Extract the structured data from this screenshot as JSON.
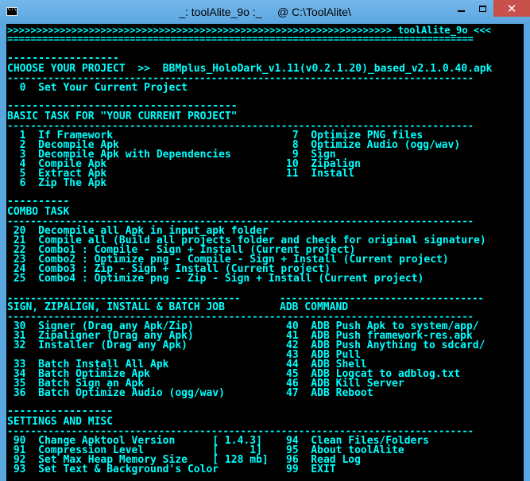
{
  "window": {
    "title": "_: toolAlite_9o :_     @ C:\\ToolAlite\\",
    "close_label": "✕"
  },
  "console": {
    "header_bar": ">>>>>>>>>>>>>>>>>>>>>>>>>>>>>>>>>>>>>>>>>>>>>>>>>>>>>>>>>>>>>>>>>> toolAlite_9o <<<",
    "rule": "================================================================================",
    "choose_rule": "------------------",
    "choose_label": "CHOOSE YOUR PROJECT  >>  BBMplus_HoloDark_v1.11(v0.2.1.20)_based_v2.1.0.40.apk",
    "dash_rule": "--------------------------------------------------------------------------------",
    "option_0": "  0  Set Your Current Project",
    "basic_rule": "-------------------------------------",
    "basic_title": "BASIC TASK FOR \"YOUR CURRENT PROJECT\"",
    "basic": [
      "  1  If Framework",
      "  2  Decompile Apk",
      "  3  Decompile Apk with Dependencies",
      "  4  Compile Apk",
      "  5  Extract Apk",
      "  6  Zip The Apk"
    ],
    "basic_right": [
      " 7  Optimize PNG files",
      " 8  Optimize Audio (ogg/wav)",
      " 9  Sign",
      "10  Zipalign",
      "11  Install",
      ""
    ],
    "combo_rule": "----------",
    "combo_title": "COMBO TASK",
    "combo": [
      " 20  Decompile all Apk in input_apk folder",
      " 21  Compile all (Build all projects folder and check for original signature)",
      " 22  Combo1 : Compile - Sign + Install (Current project)",
      " 23  Combo2 : Optimize png - Compile - Sign + Install (Current project)",
      " 24  Combo3 : Zip - Sign + Install (Current project)",
      " 25  Combo4 : Optimize png - Zip - Sign + Install (Current project)"
    ],
    "sign_rule": "----------------------------------------",
    "sign_title": "SIGN, ZIPALIGN, INSTALL & BATCH JOB",
    "adb_rule": "-----------------------------------",
    "adb_title": "ADB COMMAND",
    "sign_items": [
      " 30  Signer (Drag any Apk/Zip)",
      " 31  Zipaligner (Drag any Apk)",
      " 32  Installer (Drag any Apk)",
      "",
      " 33  Batch Install All Apk",
      " 34  Batch Optimize Apk",
      " 35  Batch Sign an Apk",
      " 36  Batch Optimize Audio (ogg/wav)"
    ],
    "adb_items": [
      "40  ADB Push Apk to system/app/",
      "41  ADB Push framework-res.apk",
      "42  ADB Push Anything to sdcard/",
      "43  ADB Pull",
      "44  ADB Shell",
      "45  ADB Logcat to adblog.txt",
      "46  ADB Kill Server",
      "47  ADB Reboot"
    ],
    "settings_rule": "-----------------",
    "settings_title": "SETTINGS AND MISC",
    "settings_left": [
      " 90  Change Apktool Version      [ 1.4.3]",
      " 91  Compression Level           [     1]",
      " 92  Set Max Heap Memory Size    [ 128 mb]",
      " 93  Set Text & Background's Color"
    ],
    "settings_right": [
      "94  Clean Files/Folders",
      "95  About toolAlite",
      "96  Read Log",
      "99  EXIT"
    ]
  }
}
